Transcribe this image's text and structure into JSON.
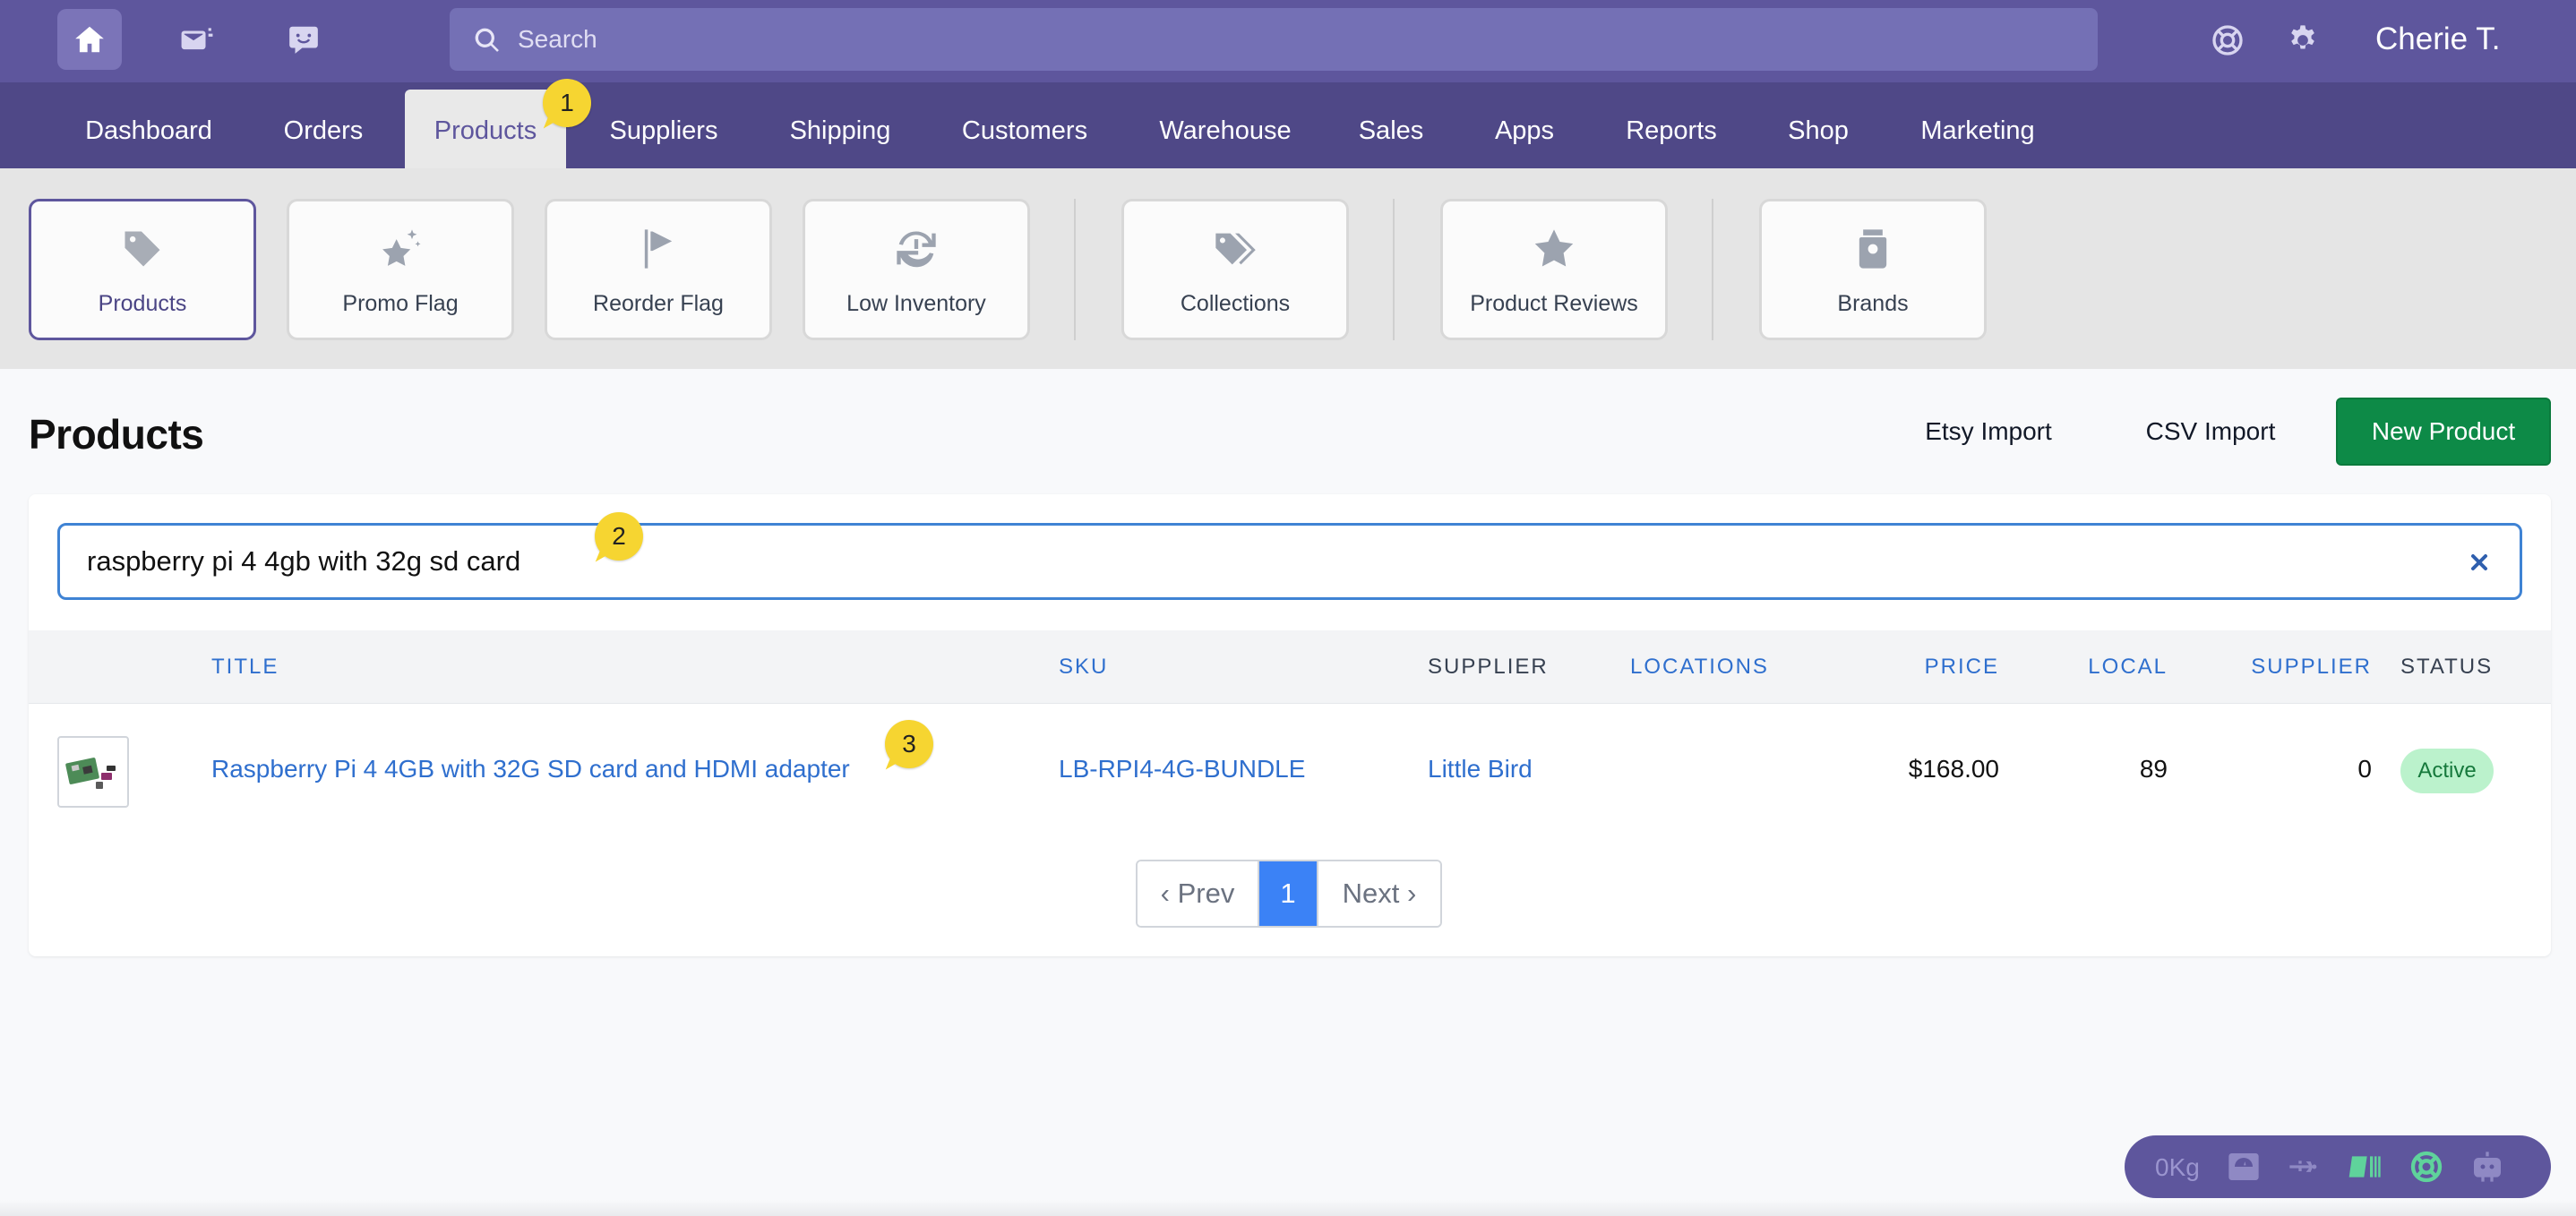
{
  "topbar": {
    "search_placeholder": "Search",
    "user_name": "Cherie T."
  },
  "nav": {
    "tabs": [
      {
        "label": "Dashboard"
      },
      {
        "label": "Orders"
      },
      {
        "label": "Products",
        "active": true
      },
      {
        "label": "Suppliers"
      },
      {
        "label": "Shipping"
      },
      {
        "label": "Customers"
      },
      {
        "label": "Warehouse"
      },
      {
        "label": "Sales"
      },
      {
        "label": "Apps"
      },
      {
        "label": "Reports"
      },
      {
        "label": "Shop"
      },
      {
        "label": "Marketing"
      }
    ]
  },
  "tiles": [
    {
      "label": "Products",
      "icon": "tag-icon",
      "active": true
    },
    {
      "label": "Promo Flag",
      "icon": "star-sparkle-icon"
    },
    {
      "label": "Reorder Flag",
      "icon": "flag-icon"
    },
    {
      "label": "Low Inventory",
      "icon": "refresh-alert-icon"
    },
    {
      "label": "Collections",
      "icon": "tags-icon"
    },
    {
      "label": "Product Reviews",
      "icon": "star-icon"
    },
    {
      "label": "Brands",
      "icon": "jar-icon"
    }
  ],
  "page": {
    "title": "Products",
    "etsy_import": "Etsy Import",
    "csv_import": "CSV Import",
    "new_product": "New Product"
  },
  "filter": {
    "value": "raspberry pi 4 4gb with 32g sd card"
  },
  "table": {
    "headers": {
      "title": "TITLE",
      "sku": "SKU",
      "supplier": "SUPPLIER",
      "locations": "LOCATIONS",
      "price": "PRICE",
      "local": "LOCAL",
      "supplier_stock": "SUPPLIER",
      "status": "STATUS"
    },
    "rows": [
      {
        "title": "Raspberry Pi 4 4GB with 32G SD card and HDMI adapter",
        "sku": "LB-RPI4-4G-BUNDLE",
        "supplier": "Little Bird",
        "locations": "",
        "price": "$168.00",
        "local": "89",
        "supplier_stock": "0",
        "status": "Active"
      }
    ]
  },
  "pagination": {
    "prev": "‹ Prev",
    "current": "1",
    "next": "Next ›"
  },
  "annotations": [
    "1",
    "2",
    "3"
  ],
  "device_bar": {
    "weight": "0Kg"
  },
  "colors": {
    "topbar": "#5e569d",
    "navbar": "#4f4887",
    "primary_button": "#0d8a47",
    "link": "#2f6fce",
    "active_badge_bg": "#bbf2cc",
    "pager_current": "#3b82f6",
    "annotation": "#f6d531"
  }
}
